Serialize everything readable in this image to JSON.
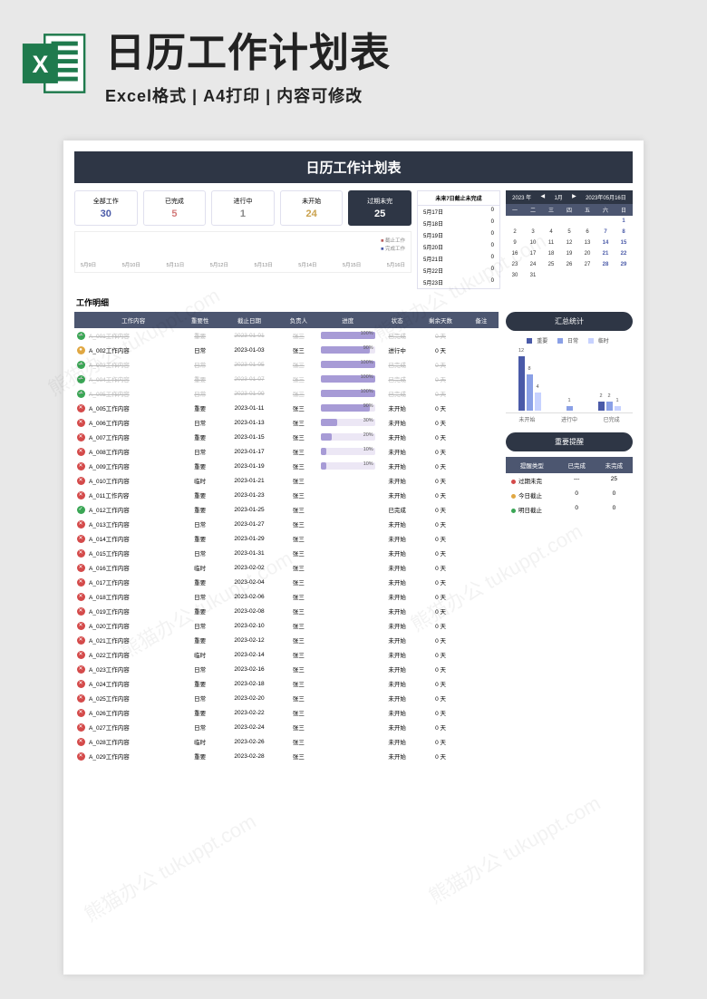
{
  "header": {
    "title": "日历工作计划表",
    "subtitle": "Excel格式  |  A4打印  |  内容可修改"
  },
  "doc_title": "日历工作计划表",
  "stats": {
    "total": {
      "label": "全部工作",
      "value": "30"
    },
    "done": {
      "label": "已完成",
      "value": "5"
    },
    "doing": {
      "label": "进行中",
      "value": "1"
    },
    "notstart": {
      "label": "未开始",
      "value": "24"
    },
    "overdue": {
      "label": "过期未完",
      "value": "25"
    }
  },
  "timeline_legend": {
    "a": "截止工作",
    "b": "完成工作"
  },
  "timeline_axis": [
    "0",
    "0",
    "0",
    "0",
    "0",
    "0",
    "0",
    "0",
    "0",
    "0"
  ],
  "timeline_dates": [
    "5月9日",
    "5月10日",
    "5月11日",
    "5月12日",
    "5月13日",
    "5月14日",
    "5月15日",
    "5月16日"
  ],
  "upcoming": {
    "title": "未来7日截止未完成",
    "rows": [
      {
        "date": "5月17日",
        "count": "0"
      },
      {
        "date": "5月18日",
        "count": "0"
      },
      {
        "date": "5月19日",
        "count": "0"
      },
      {
        "date": "5月20日",
        "count": "0"
      },
      {
        "date": "5月21日",
        "count": "0"
      },
      {
        "date": "5月22日",
        "count": "0"
      },
      {
        "date": "5月23日",
        "count": "0"
      }
    ]
  },
  "calendar": {
    "year_label": "2023 年",
    "month_label": "1月",
    "date_label": "2023年05月16日",
    "dow": [
      "一",
      "二",
      "三",
      "四",
      "五",
      "六",
      "日"
    ],
    "cells": [
      "",
      "",
      "",
      "",
      "",
      "",
      "1",
      "2",
      "3",
      "4",
      "5",
      "6",
      "7",
      "8",
      "9",
      "10",
      "11",
      "12",
      "13",
      "14",
      "15",
      "16",
      "17",
      "18",
      "19",
      "20",
      "21",
      "22",
      "23",
      "24",
      "25",
      "26",
      "27",
      "28",
      "29",
      "30",
      "31",
      "",
      "",
      "",
      "",
      ""
    ]
  },
  "detail_title": "工作明细",
  "task_headers": [
    "",
    "工作内容",
    "重要性",
    "截止日期",
    "负责人",
    "进度",
    "状态",
    "剩余天数",
    "备注"
  ],
  "tasks": [
    {
      "ico": "ok",
      "name": "A_001工作内容",
      "imp": "重要",
      "due": "2023-01-01",
      "who": "张三",
      "prog": 100,
      "status": "已完成",
      "left": "0 天"
    },
    {
      "ico": "warn",
      "name": "A_002工作内容",
      "imp": "日常",
      "due": "2023-01-03",
      "who": "张三",
      "prog": 90,
      "status": "进行中",
      "left": "0 天"
    },
    {
      "ico": "ok",
      "name": "A_003工作内容",
      "imp": "日常",
      "due": "2023-01-05",
      "who": "张三",
      "prog": 100,
      "status": "已完成",
      "left": "0 天"
    },
    {
      "ico": "ok",
      "name": "A_004工作内容",
      "imp": "重要",
      "due": "2023-01-07",
      "who": "张三",
      "prog": 100,
      "status": "已完成",
      "left": "0 天"
    },
    {
      "ico": "ok",
      "name": "A_005工作内容",
      "imp": "日常",
      "due": "2023-01-09",
      "who": "张三",
      "prog": 100,
      "status": "已完成",
      "left": "0 天"
    },
    {
      "ico": "no",
      "name": "A_005工作内容",
      "imp": "重要",
      "due": "2023-01-11",
      "who": "张三",
      "prog": 90,
      "status": "未开始",
      "left": "0 天"
    },
    {
      "ico": "no",
      "name": "A_006工作内容",
      "imp": "日常",
      "due": "2023-01-13",
      "who": "张三",
      "prog": 30,
      "status": "未开始",
      "left": "0 天"
    },
    {
      "ico": "no",
      "name": "A_007工作内容",
      "imp": "重要",
      "due": "2023-01-15",
      "who": "张三",
      "prog": 20,
      "status": "未开始",
      "left": "0 天"
    },
    {
      "ico": "no",
      "name": "A_008工作内容",
      "imp": "日常",
      "due": "2023-01-17",
      "who": "张三",
      "prog": 10,
      "status": "未开始",
      "left": "0 天"
    },
    {
      "ico": "no",
      "name": "A_009工作内容",
      "imp": "重要",
      "due": "2023-01-19",
      "who": "张三",
      "prog": 10,
      "status": "未开始",
      "left": "0 天"
    },
    {
      "ico": "no",
      "name": "A_010工作内容",
      "imp": "临时",
      "due": "2023-01-21",
      "who": "张三",
      "prog": 0,
      "status": "未开始",
      "left": "0 天"
    },
    {
      "ico": "no",
      "name": "A_011工作内容",
      "imp": "重要",
      "due": "2023-01-23",
      "who": "张三",
      "prog": 0,
      "status": "未开始",
      "left": "0 天"
    },
    {
      "ico": "ok",
      "name": "A_012工作内容",
      "imp": "重要",
      "due": "2023-01-25",
      "who": "张三",
      "prog": 0,
      "status": "已完成",
      "left": "0 天"
    },
    {
      "ico": "no",
      "name": "A_013工作内容",
      "imp": "日常",
      "due": "2023-01-27",
      "who": "张三",
      "prog": 0,
      "status": "未开始",
      "left": "0 天"
    },
    {
      "ico": "no",
      "name": "A_014工作内容",
      "imp": "重要",
      "due": "2023-01-29",
      "who": "张三",
      "prog": 0,
      "status": "未开始",
      "left": "0 天"
    },
    {
      "ico": "no",
      "name": "A_015工作内容",
      "imp": "日常",
      "due": "2023-01-31",
      "who": "张三",
      "prog": 0,
      "status": "未开始",
      "left": "0 天"
    },
    {
      "ico": "no",
      "name": "A_016工作内容",
      "imp": "临时",
      "due": "2023-02-02",
      "who": "张三",
      "prog": 0,
      "status": "未开始",
      "left": "0 天"
    },
    {
      "ico": "no",
      "name": "A_017工作内容",
      "imp": "重要",
      "due": "2023-02-04",
      "who": "张三",
      "prog": 0,
      "status": "未开始",
      "left": "0 天"
    },
    {
      "ico": "no",
      "name": "A_018工作内容",
      "imp": "日常",
      "due": "2023-02-06",
      "who": "张三",
      "prog": 0,
      "status": "未开始",
      "left": "0 天"
    },
    {
      "ico": "no",
      "name": "A_019工作内容",
      "imp": "重要",
      "due": "2023-02-08",
      "who": "张三",
      "prog": 0,
      "status": "未开始",
      "left": "0 天"
    },
    {
      "ico": "no",
      "name": "A_020工作内容",
      "imp": "日常",
      "due": "2023-02-10",
      "who": "张三",
      "prog": 0,
      "status": "未开始",
      "left": "0 天"
    },
    {
      "ico": "no",
      "name": "A_021工作内容",
      "imp": "重要",
      "due": "2023-02-12",
      "who": "张三",
      "prog": 0,
      "status": "未开始",
      "left": "0 天"
    },
    {
      "ico": "no",
      "name": "A_022工作内容",
      "imp": "临时",
      "due": "2023-02-14",
      "who": "张三",
      "prog": 0,
      "status": "未开始",
      "left": "0 天"
    },
    {
      "ico": "no",
      "name": "A_023工作内容",
      "imp": "日常",
      "due": "2023-02-16",
      "who": "张三",
      "prog": 0,
      "status": "未开始",
      "left": "0 天"
    },
    {
      "ico": "no",
      "name": "A_024工作内容",
      "imp": "重要",
      "due": "2023-02-18",
      "who": "张三",
      "prog": 0,
      "status": "未开始",
      "left": "0 天"
    },
    {
      "ico": "no",
      "name": "A_025工作内容",
      "imp": "日常",
      "due": "2023-02-20",
      "who": "张三",
      "prog": 0,
      "status": "未开始",
      "left": "0 天"
    },
    {
      "ico": "no",
      "name": "A_026工作内容",
      "imp": "重要",
      "due": "2023-02-22",
      "who": "张三",
      "prog": 0,
      "status": "未开始",
      "left": "0 天"
    },
    {
      "ico": "no",
      "name": "A_027工作内容",
      "imp": "日常",
      "due": "2023-02-24",
      "who": "张三",
      "prog": 0,
      "status": "未开始",
      "left": "0 天"
    },
    {
      "ico": "no",
      "name": "A_028工作内容",
      "imp": "临时",
      "due": "2023-02-26",
      "who": "张三",
      "prog": 0,
      "status": "未开始",
      "left": "0 天"
    },
    {
      "ico": "no",
      "name": "A_029工作内容",
      "imp": "重要",
      "due": "2023-02-28",
      "who": "张三",
      "prog": 0,
      "status": "未开始",
      "left": "0 天"
    }
  ],
  "summary": {
    "title": "汇总统计",
    "legend": {
      "a": "重要",
      "b": "日常",
      "c": "临时"
    },
    "x": [
      "未开始",
      "进行中",
      "已完成"
    ],
    "groups": [
      {
        "v": [
          12,
          8,
          4
        ]
      },
      {
        "v": [
          0,
          1,
          0
        ]
      },
      {
        "v": [
          2,
          2,
          1
        ]
      }
    ]
  },
  "reminder": {
    "title": "重要提醒",
    "headers": [
      "提醒类型",
      "已完成",
      "未完成"
    ],
    "rows": [
      {
        "dot": "r",
        "label": "过期未完",
        "a": "---",
        "b": "25"
      },
      {
        "dot": "y",
        "label": "今日截止",
        "a": "0",
        "b": "0"
      },
      {
        "dot": "g",
        "label": "明日截止",
        "a": "0",
        "b": "0"
      }
    ]
  },
  "watermark_text": "熊猫办公 tukuppt.com"
}
